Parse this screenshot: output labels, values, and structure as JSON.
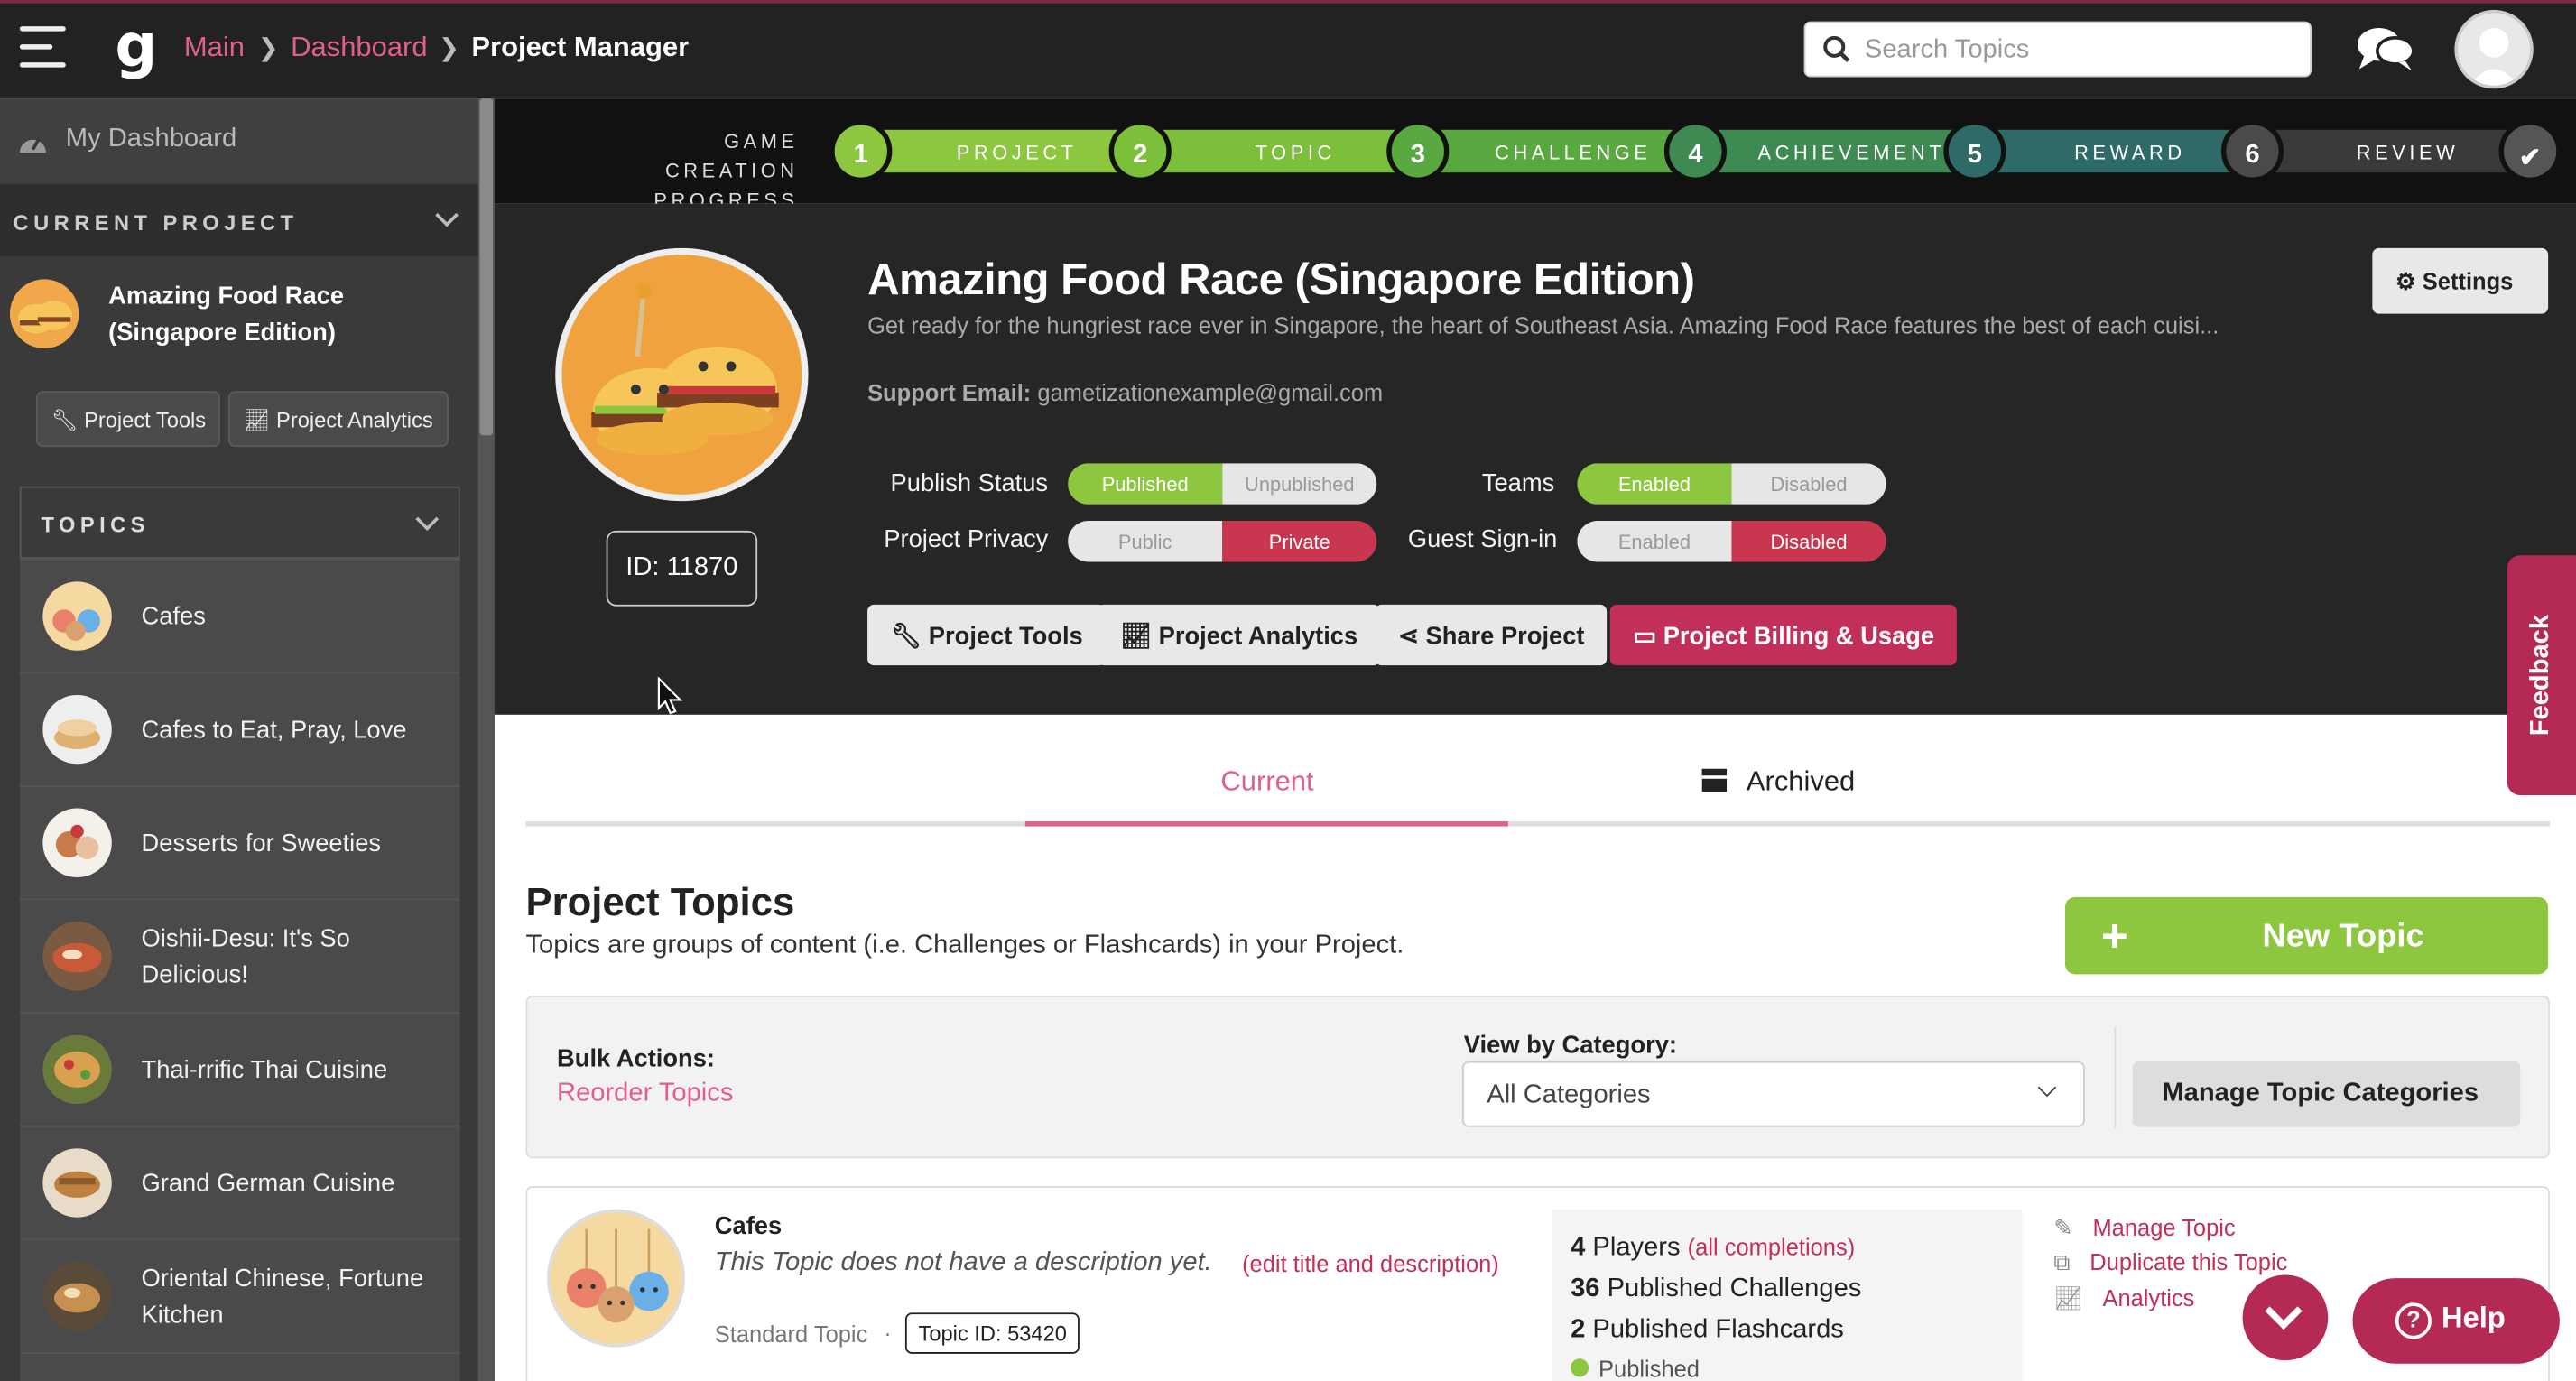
{
  "header": {
    "logo": "g",
    "breadcrumb": [
      "Main",
      "Dashboard",
      "Project Manager"
    ],
    "search_placeholder": "Search Topics"
  },
  "sidebar": {
    "my_dashboard": "My Dashboard",
    "current_project_label": "CURRENT PROJECT",
    "project_name_line1": "Amazing Food Race",
    "project_name_line2": "(Singapore Edition)",
    "btn_tools": "Project Tools",
    "btn_analytics": "Project Analytics",
    "topics_label": "TOPICS",
    "topics": [
      {
        "l1": "Cafes",
        "l2": ""
      },
      {
        "l1": "Cafes to Eat, Pray, Love",
        "l2": ""
      },
      {
        "l1": "Desserts for Sweeties",
        "l2": ""
      },
      {
        "l1": "Oishii-Desu: It's So",
        "l2": "Delicious!"
      },
      {
        "l1": "Thai-rrific Thai Cuisine",
        "l2": ""
      },
      {
        "l1": "Grand German Cuisine",
        "l2": ""
      },
      {
        "l1": "Oriental Chinese, Fortune",
        "l2": "Kitchen"
      }
    ]
  },
  "progress": {
    "label_line1": "GAME CREATION",
    "label_line2": "PROGRESS",
    "steps": [
      {
        "num": "1",
        "label": "PROJECT"
      },
      {
        "num": "2",
        "label": "TOPIC"
      },
      {
        "num": "3",
        "label": "CHALLENGE"
      },
      {
        "num": "4",
        "label": "ACHIEVEMENT"
      },
      {
        "num": "5",
        "label": "REWARD"
      },
      {
        "num": "6",
        "label": "REVIEW"
      }
    ],
    "final_mark": "✔"
  },
  "project": {
    "title": "Amazing Food Race (Singapore Edition)",
    "description": "Get ready for the hungriest race ever in Singapore, the heart of Southeast Asia. Amazing Food Race features the best of each cuisi...",
    "support_label": "Support Email:",
    "support_email": "gametizationexample@gmail.com",
    "id": "ID: 11870",
    "settings": "Settings",
    "publish_status": {
      "label": "Publish Status",
      "a": "Published",
      "b": "Unpublished"
    },
    "privacy": {
      "label": "Project Privacy",
      "a": "Public",
      "b": "Private"
    },
    "teams": {
      "label": "Teams",
      "a": "Enabled",
      "b": "Disabled"
    },
    "guest": {
      "label": "Guest Sign-in",
      "a": "Enabled",
      "b": "Disabled"
    },
    "actions": [
      "Project Tools",
      "Project Analytics",
      "Share Project",
      "Project Billing & Usage"
    ]
  },
  "feedback": "Feedback",
  "tabs": {
    "current": "Current",
    "archived": "Archived"
  },
  "topics_section": {
    "title": "Project Topics",
    "desc": "Topics are groups of content (i.e. Challenges or Flashcards) in your Project.",
    "new_topic": "New Topic",
    "bulk_label": "Bulk Actions:",
    "reorder": "Reorder Topics",
    "view_label": "View by Category:",
    "category_value": "All Categories",
    "manage_categories": "Manage Topic Categories"
  },
  "topic_card": {
    "title": "Cafes",
    "desc": "This Topic does not have a description yet.",
    "edit": "(edit title and description)",
    "type": "Standard Topic",
    "dot": "·",
    "topic_id": "Topic ID: 53420",
    "players_num": "4",
    "players_label": "Players",
    "all_completions": "(all completions)",
    "challenges_num": "36",
    "challenges_label": "Published Challenges",
    "flashcards_num": "2",
    "flashcards_label": "Published Flashcards",
    "status": "Published",
    "manage": "Manage Topic",
    "duplicate": "Duplicate this Topic",
    "analytics": "Analytics"
  },
  "help": "Help",
  "colors": {
    "accent": "#e0608a",
    "green": "#8dc63f",
    "dark_pink": "#b52a55"
  }
}
